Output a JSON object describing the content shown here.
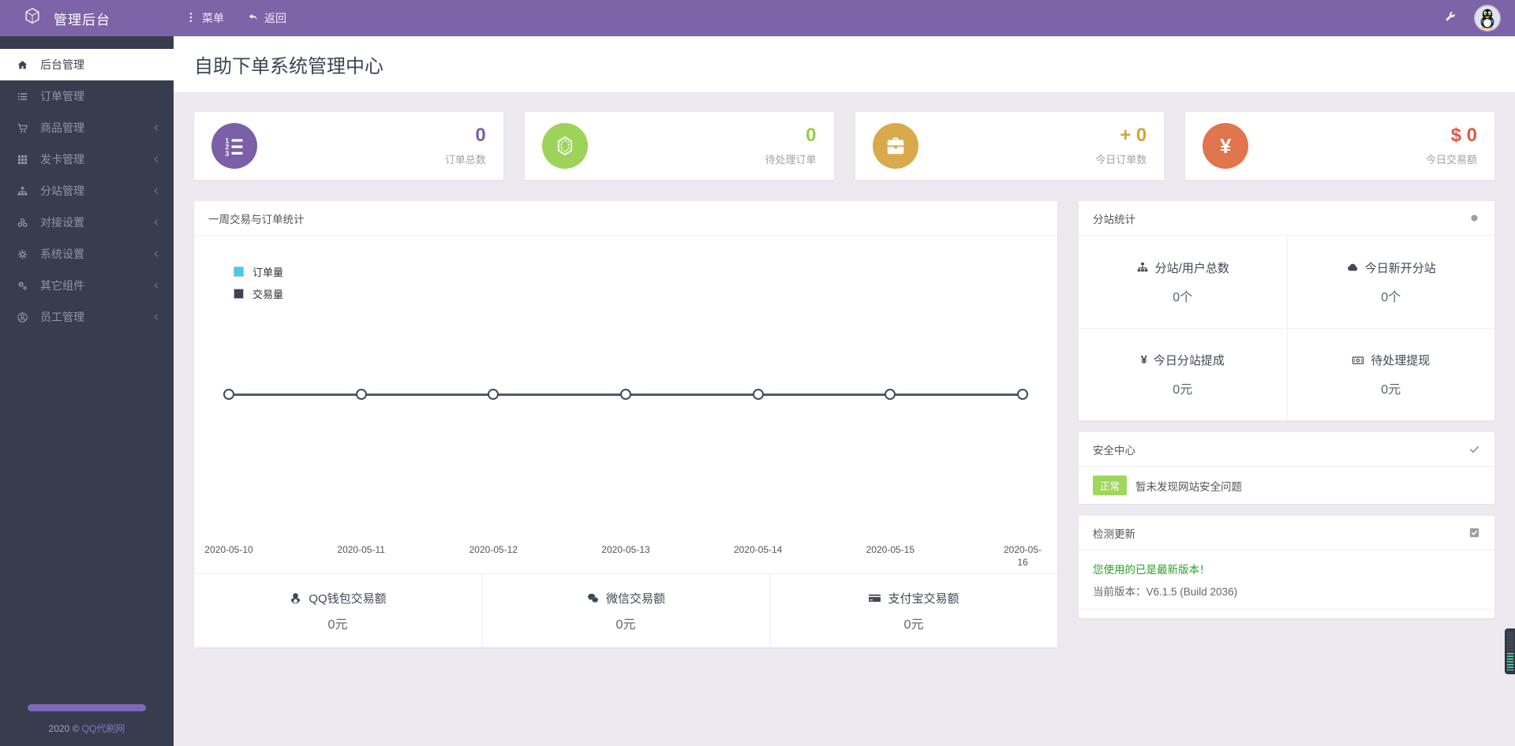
{
  "topbar": {
    "title": "管理后台",
    "menu_label": "菜单",
    "back_label": "返回",
    "accent_color": "#7d63a8"
  },
  "sidebar": {
    "items": [
      {
        "label": "后台管理",
        "icon": "home-icon",
        "active": true,
        "has_children": false
      },
      {
        "label": "订单管理",
        "icon": "list-icon",
        "active": false,
        "has_children": false
      },
      {
        "label": "商品管理",
        "icon": "cart-icon",
        "active": false,
        "has_children": true
      },
      {
        "label": "发卡管理",
        "icon": "grid-icon",
        "active": false,
        "has_children": true
      },
      {
        "label": "分站管理",
        "icon": "sitemap-icon",
        "active": false,
        "has_children": true
      },
      {
        "label": "对接设置",
        "icon": "circles-icon",
        "active": false,
        "has_children": true
      },
      {
        "label": "系统设置",
        "icon": "gear-icon",
        "active": false,
        "has_children": true
      },
      {
        "label": "其它组件",
        "icon": "gears-icon",
        "active": false,
        "has_children": true
      },
      {
        "label": "员工管理",
        "icon": "user-circle-icon",
        "active": false,
        "has_children": true
      }
    ],
    "footer_text": "2020 ©",
    "footer_link": "QQ代刷网"
  },
  "page": {
    "title": "自助下单系统管理中心"
  },
  "stat_cards": [
    {
      "icon": "list-ol-icon",
      "circle_color": "#7b5fa8",
      "value": "0",
      "value_color": "#7b5fa8",
      "label": "订单总数"
    },
    {
      "icon": "gem-icon",
      "circle_color": "#9ed359",
      "value": "0",
      "value_color": "#97cc41",
      "label": "待处理订单"
    },
    {
      "icon": "briefcase-icon",
      "circle_color": "#d9a94c",
      "value": "+ 0",
      "value_color": "#d4a53a",
      "label": "今日订单数"
    },
    {
      "icon": "yen-icon",
      "circle_color": "#e0754e",
      "value": "$ 0",
      "value_color": "#e25a4a",
      "label": "今日交易额"
    }
  ],
  "chart_card": {
    "title": "一周交易与订单统计",
    "chart_data": {
      "type": "line",
      "title": "一周交易与订单统计",
      "x": [
        "2020-05-10",
        "2020-05-11",
        "2020-05-12",
        "2020-05-13",
        "2020-05-14",
        "2020-05-15",
        "2020-05-16"
      ],
      "series": [
        {
          "name": "订单量",
          "color": "#3ed0e8",
          "values": [
            0,
            0,
            0,
            0,
            0,
            0,
            0
          ]
        },
        {
          "name": "交易量",
          "color": "#3a4552",
          "values": [
            0,
            0,
            0,
            0,
            0,
            0,
            0
          ]
        }
      ],
      "ylim": [
        0,
        1
      ],
      "grid": false,
      "legend_position": "top-left",
      "line_color": "#4d5d6c",
      "marker": "open-circle"
    },
    "payments": [
      {
        "icon": "qq-icon",
        "label": "QQ钱包交易额",
        "value": "0元"
      },
      {
        "icon": "wechat-icon",
        "label": "微信交易额",
        "value": "0元"
      },
      {
        "icon": "credit-card-icon",
        "label": "支付宝交易额",
        "value": "0元"
      }
    ]
  },
  "substation": {
    "title": "分站统计",
    "header_icon": "dot-icon",
    "cells": [
      {
        "icon": "sitemap-icon",
        "label": "分站/用户总数",
        "value": "0个"
      },
      {
        "icon": "cloud-icon",
        "label": "今日新开分站",
        "value": "0个"
      },
      {
        "icon": "yen-icon",
        "label": "今日分站提成",
        "value": "0元"
      },
      {
        "icon": "money-icon",
        "label": "待处理提现",
        "value": "0元"
      }
    ]
  },
  "security": {
    "title": "安全中心",
    "header_icon": "check-icon",
    "status_badge": "正常",
    "badge_color": "#9ed75a",
    "message": "暂未发现网站安全问题"
  },
  "update": {
    "title": "检测更新",
    "header_icon": "checkbox-icon",
    "latest_message": "您使用的已是最新版本！",
    "latest_color": "#28a428",
    "version_line": "当前版本：V6.1.5 (Build 2036)"
  }
}
